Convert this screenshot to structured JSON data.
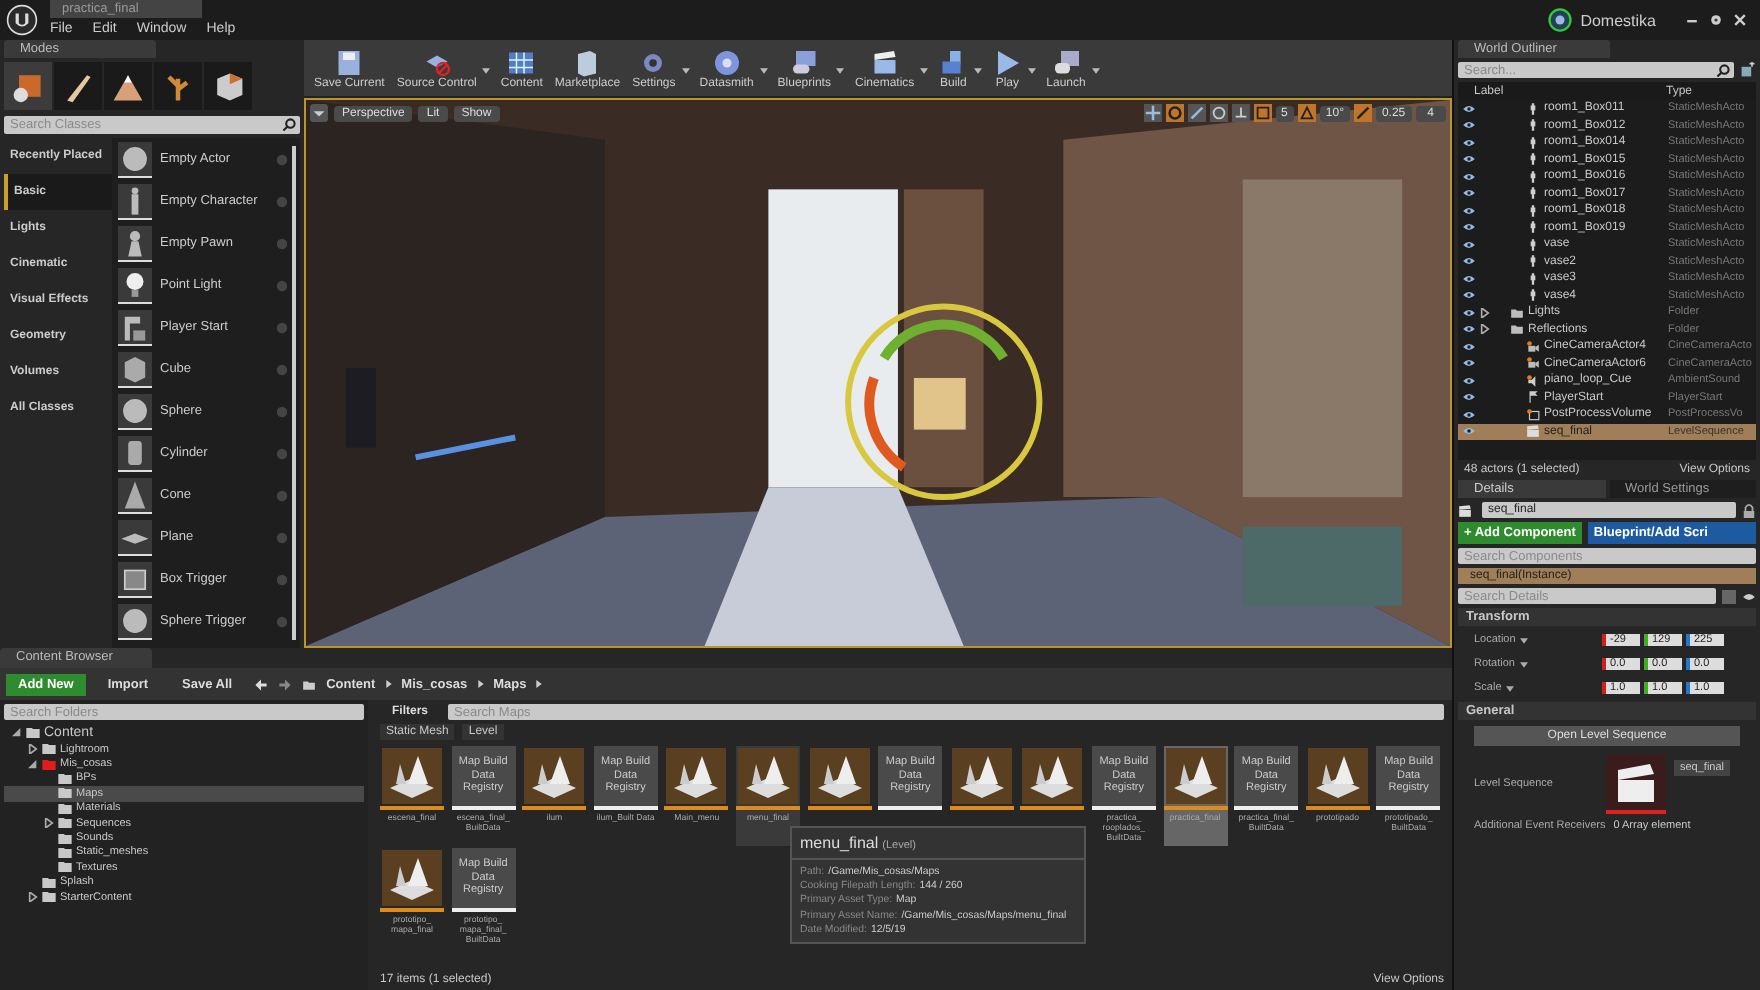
{
  "title_bar": {
    "document_tab": "practica_final",
    "account": "Domestika"
  },
  "menu": [
    "File",
    "Edit",
    "Window",
    "Help"
  ],
  "modes": {
    "tab": "Modes",
    "mode_tools": [
      {
        "kind": "place",
        "selected": true
      },
      {
        "kind": "paint",
        "selected": false
      },
      {
        "kind": "landscape",
        "selected": false
      },
      {
        "kind": "foliage",
        "selected": false
      },
      {
        "kind": "geometry",
        "selected": false
      }
    ],
    "search": {
      "placeholder": "Search Classes"
    },
    "categories": [
      {
        "label": "Recently Placed",
        "selected": false
      },
      {
        "label": "Basic",
        "selected": true
      },
      {
        "label": "Lights",
        "selected": false
      },
      {
        "label": "Cinematic",
        "selected": false
      },
      {
        "label": "Visual Effects",
        "selected": false
      },
      {
        "label": "Geometry",
        "selected": false
      },
      {
        "label": "Volumes",
        "selected": false
      },
      {
        "label": "All Classes",
        "selected": false
      }
    ],
    "items": [
      {
        "label": "Empty Actor",
        "kind": "sphere"
      },
      {
        "label": "Empty Character",
        "kind": "figure"
      },
      {
        "label": "Empty Pawn",
        "kind": "pawn"
      },
      {
        "label": "Point Light",
        "kind": "bulb"
      },
      {
        "label": "Player Start",
        "kind": "player"
      },
      {
        "label": "Cube",
        "kind": "cube"
      },
      {
        "label": "Sphere",
        "kind": "sphere"
      },
      {
        "label": "Cylinder",
        "kind": "cylinder"
      },
      {
        "label": "Cone",
        "kind": "cone"
      },
      {
        "label": "Plane",
        "kind": "plane"
      },
      {
        "label": "Box Trigger",
        "kind": "box"
      },
      {
        "label": "Sphere Trigger",
        "kind": "sphere"
      }
    ]
  },
  "toolbar": [
    {
      "label": "Save Current",
      "kind": "save",
      "dropdown": false
    },
    {
      "label": "Source Control",
      "kind": "source",
      "dropdown": true
    },
    {
      "label": "Content",
      "kind": "content",
      "dropdown": false
    },
    {
      "label": "Marketplace",
      "kind": "market",
      "dropdown": false
    },
    {
      "label": "Settings",
      "kind": "settings",
      "dropdown": true
    },
    {
      "label": "Datasmith",
      "kind": "datasmith",
      "dropdown": true
    },
    {
      "label": "Blueprints",
      "kind": "blueprints",
      "dropdown": true
    },
    {
      "label": "Cinematics",
      "kind": "cinematics",
      "dropdown": true
    },
    {
      "label": "Build",
      "kind": "build",
      "dropdown": true
    },
    {
      "label": "Play",
      "kind": "play",
      "dropdown": true
    },
    {
      "label": "Launch",
      "kind": "launch",
      "dropdown": true
    }
  ],
  "viewport": {
    "view": "Perspective",
    "lighting": "Lit",
    "show": "Show",
    "grid_snap": "5",
    "rotation_snap": "10°",
    "scale_snap": "0.25",
    "camera_speed": "4"
  },
  "world_outliner": {
    "tab": "World Outliner",
    "search": {
      "placeholder": "Search..."
    },
    "columns": [
      "Label",
      "Type"
    ],
    "rows": [
      {
        "label": "room1_Box011",
        "type": "StaticMeshActo",
        "kind": "mesh",
        "selected": false
      },
      {
        "label": "room1_Box012",
        "type": "StaticMeshActo",
        "kind": "mesh",
        "selected": false
      },
      {
        "label": "room1_Box014",
        "type": "StaticMeshActo",
        "kind": "mesh",
        "selected": false
      },
      {
        "label": "room1_Box015",
        "type": "StaticMeshActo",
        "kind": "mesh",
        "selected": false
      },
      {
        "label": "room1_Box016",
        "type": "StaticMeshActo",
        "kind": "mesh",
        "selected": false
      },
      {
        "label": "room1_Box017",
        "type": "StaticMeshActo",
        "kind": "mesh",
        "selected": false
      },
      {
        "label": "room1_Box018",
        "type": "StaticMeshActo",
        "kind": "mesh",
        "selected": false
      },
      {
        "label": "room1_Box019",
        "type": "StaticMeshActo",
        "kind": "mesh",
        "selected": false
      },
      {
        "label": "vase",
        "type": "StaticMeshActo",
        "kind": "mesh",
        "selected": false
      },
      {
        "label": "vase2",
        "type": "StaticMeshActo",
        "kind": "mesh",
        "selected": false
      },
      {
        "label": "vase3",
        "type": "StaticMeshActo",
        "kind": "mesh",
        "selected": false
      },
      {
        "label": "vase4",
        "type": "StaticMeshActo",
        "kind": "mesh",
        "selected": false
      },
      {
        "label": "Lights",
        "type": "Folder",
        "kind": "folder",
        "expanded": false,
        "selected": false
      },
      {
        "label": "Reflections",
        "type": "Folder",
        "kind": "folder",
        "expanded": false,
        "selected": false
      },
      {
        "label": "CineCameraActor4",
        "type": "CineCameraActo",
        "kind": "camera",
        "selected": false
      },
      {
        "label": "CineCameraActor6",
        "type": "CineCameraActo",
        "kind": "camera",
        "selected": false
      },
      {
        "label": "piano_loop_Cue",
        "type": "AmbientSound",
        "kind": "sound",
        "selected": false
      },
      {
        "label": "PlayerStart",
        "type": "PlayerStart",
        "kind": "player",
        "selected": false
      },
      {
        "label": "PostProcessVolume",
        "type": "PostProcessVo",
        "kind": "volume",
        "selected": false
      },
      {
        "label": "seq_final",
        "type": "LevelSequence",
        "kind": "sequence",
        "selected": true
      }
    ],
    "footer": "48 actors (1 selected)",
    "view_options": "View Options"
  },
  "details": {
    "tabs": [
      {
        "label": "Details",
        "selected": true
      },
      {
        "label": "World Settings",
        "selected": false
      }
    ],
    "actor_name": "seq_final",
    "add_component": "+ Add Component",
    "blueprint": "Blueprint/Add Scri",
    "search_components": {
      "placeholder": "Search Components"
    },
    "component": "seq_final(Instance)",
    "search_details": {
      "placeholder": "Search Details"
    },
    "sections": [
      {
        "title": "Transform",
        "kind": "transform",
        "rows": [
          {
            "label": "Location",
            "values": [
              "-29",
              "129",
              "225"
            ]
          },
          {
            "label": "Rotation",
            "values": [
              "0.0",
              "0.0",
              "0.0"
            ]
          },
          {
            "label": "Scale",
            "values": [
              "1.0",
              "1.0",
              "1.0"
            ]
          }
        ]
      },
      {
        "title": "General",
        "kind": "general",
        "button": "Open Level Sequence",
        "sequence_label": "Level Sequence",
        "sequence_value": "seq_final",
        "receivers_label": "Additional Event Receivers",
        "receivers_value": "0 Array element"
      }
    ]
  },
  "content_browser": {
    "tab": "Content Browser",
    "add_new": "Add New",
    "import": "Import",
    "save_all": "Save All",
    "path": [
      "Content",
      "Mis_cosas",
      "Maps"
    ],
    "folder_search": {
      "placeholder": "Search Folders"
    },
    "tree": [
      {
        "label": "Content",
        "expanded": true,
        "selected": false,
        "color": "#c8c8c8",
        "children": [
          {
            "label": "Lightroom",
            "expanded": false,
            "selected": false,
            "color": "#c8c8c8"
          },
          {
            "label": "Mis_cosas",
            "expanded": true,
            "selected": false,
            "color": "#e01c1c",
            "children": [
              {
                "label": "BPs",
                "selected": false,
                "color": "#c8c8c8"
              },
              {
                "label": "Maps",
                "selected": true,
                "color": "#c8c8c8"
              },
              {
                "label": "Materials",
                "selected": false,
                "color": "#c8c8c8"
              },
              {
                "label": "Sequences",
                "expanded": false,
                "selected": false,
                "color": "#c8c8c8"
              },
              {
                "label": "Sounds",
                "selected": false,
                "color": "#c8c8c8"
              },
              {
                "label": "Static_meshes",
                "selected": false,
                "color": "#c8c8c8"
              },
              {
                "label": "Textures",
                "selected": false,
                "color": "#c8c8c8"
              }
            ]
          },
          {
            "label": "Splash",
            "selected": false,
            "color": "#c8c8c8"
          },
          {
            "label": "StarterContent",
            "expanded": false,
            "selected": false,
            "color": "#c8c8c8"
          }
        ]
      }
    ],
    "filters": "Filters",
    "asset_search": {
      "placeholder": "Search Maps"
    },
    "filter_chips": [
      "Static Mesh",
      "Level"
    ],
    "assets": [
      {
        "kind": "level",
        "label": "escena_final",
        "selected": false,
        "hovered": false
      },
      {
        "kind": "registry",
        "text": "Map Build Data Registry",
        "label": "escena_final_ BuiltData",
        "selected": false,
        "hovered": false
      },
      {
        "kind": "level",
        "label": "ilum",
        "selected": false,
        "hovered": false
      },
      {
        "kind": "registry",
        "text": "Map Build Data Registry",
        "label": "ilum_Built Data",
        "selected": false,
        "hovered": false
      },
      {
        "kind": "level",
        "label": "Main_menu",
        "selected": false,
        "hovered": false
      },
      {
        "kind": "level",
        "label": "menu_final",
        "selected": false,
        "hovered": true
      },
      {
        "kind": "level",
        "selected": false,
        "hovered": false
      },
      {
        "kind": "registry",
        "text": "Map Build Data Registry",
        "selected": false,
        "hovered": false
      },
      {
        "kind": "level",
        "selected": false,
        "hovered": false
      },
      {
        "kind": "level",
        "selected": false,
        "hovered": false
      },
      {
        "kind": "registry",
        "text": "Map Build Data Registry",
        "label": "practica_ rooplados_ BuiltData",
        "selected": false,
        "hovered": false
      },
      {
        "kind": "level",
        "label": "practica_final",
        "selected": true,
        "hovered": false
      },
      {
        "kind": "registry",
        "text": "Map Build Data Registry",
        "label": "practica_final_ BuiltData",
        "selected": false,
        "hovered": false
      },
      {
        "kind": "level",
        "label": "prototipado",
        "selected": false,
        "hovered": false
      },
      {
        "kind": "registry",
        "text": "Map Build Data Registry",
        "label": "prototipado_ BuiltData",
        "selected": false,
        "hovered": false
      },
      {
        "kind": "level",
        "label": "prototipo_ mapa_final",
        "selected": false,
        "hovered": false
      },
      {
        "kind": "registry",
        "text": "Map Build Data Registry",
        "label": "prototipo_ mapa_final_ BuiltData",
        "selected": false,
        "hovered": false
      }
    ],
    "tooltip": {
      "name": "menu_final",
      "type": "(Level)",
      "rows": [
        {
          "key": "Path:",
          "value": "/Game/Mis_cosas/Maps"
        },
        {
          "key": "Cooking Filepath Length:",
          "value": "144 / 260"
        },
        {
          "key": "Primary Asset Type:",
          "value": "Map"
        },
        {
          "key": "Primary Asset Name:",
          "value": "/Game/Mis_cosas/Maps/menu_final"
        },
        {
          "key": "Date Modified:",
          "value": "12/5/19"
        }
      ]
    },
    "footer": "17 items (1 selected)",
    "view_options": "View Options"
  }
}
